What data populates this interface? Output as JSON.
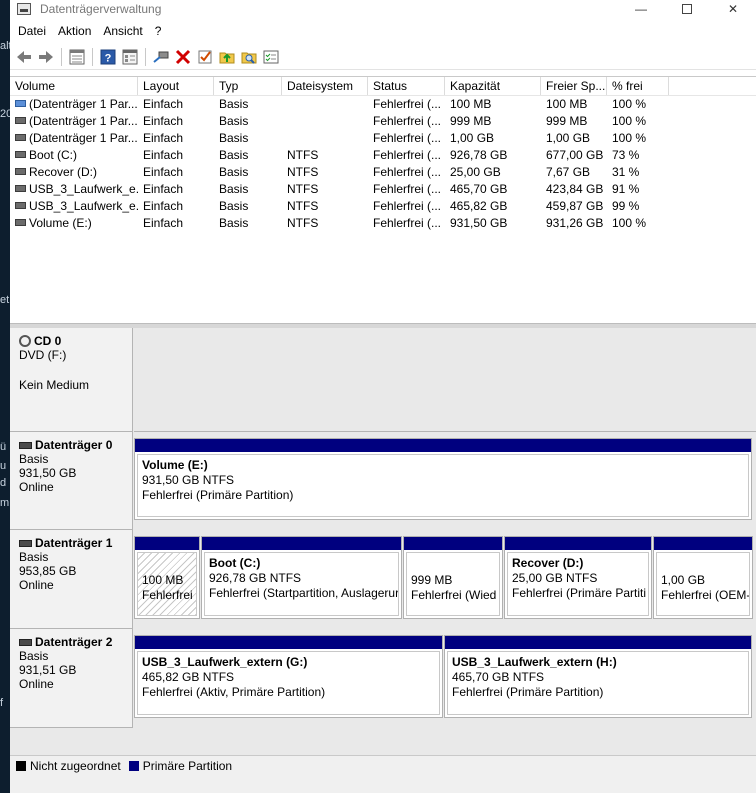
{
  "window": {
    "title": "Datenträgerverwaltung"
  },
  "menu": [
    "Datei",
    "Aktion",
    "Ansicht",
    "?"
  ],
  "desktop_fragments": [
    "alt",
    "20",
    "ü",
    "u",
    "d",
    "et",
    "m",
    "f"
  ],
  "toolbar_icons": [
    "back-icon",
    "forward-icon",
    "list-view-icon",
    "help-icon",
    "properties-icon",
    "connect-icon",
    "delete-icon",
    "check-icon",
    "folder-up-icon",
    "search-folder-icon",
    "properties-list-icon"
  ],
  "columns": [
    "Volume",
    "Layout",
    "Typ",
    "Dateisystem",
    "Status",
    "Kapazität",
    "Freier Sp...",
    "% frei"
  ],
  "volumes": [
    {
      "name": "(Datenträger 1 Par...",
      "layout": "Einfach",
      "type": "Basis",
      "fs": "",
      "status": "Fehlerfrei (...",
      "capacity": "100 MB",
      "free": "100 MB",
      "pct": "100 %",
      "icon": "blue"
    },
    {
      "name": "(Datenträger 1 Par...",
      "layout": "Einfach",
      "type": "Basis",
      "fs": "",
      "status": "Fehlerfrei (...",
      "capacity": "999 MB",
      "free": "999 MB",
      "pct": "100 %",
      "icon": "gray"
    },
    {
      "name": "(Datenträger 1 Par...",
      "layout": "Einfach",
      "type": "Basis",
      "fs": "",
      "status": "Fehlerfrei (...",
      "capacity": "1,00 GB",
      "free": "1,00 GB",
      "pct": "100 %",
      "icon": "gray"
    },
    {
      "name": "Boot (C:)",
      "layout": "Einfach",
      "type": "Basis",
      "fs": "NTFS",
      "status": "Fehlerfrei (...",
      "capacity": "926,78 GB",
      "free": "677,00 GB",
      "pct": "73 %",
      "icon": "gray"
    },
    {
      "name": "Recover (D:)",
      "layout": "Einfach",
      "type": "Basis",
      "fs": "NTFS",
      "status": "Fehlerfrei (...",
      "capacity": "25,00 GB",
      "free": "7,67 GB",
      "pct": "31 %",
      "icon": "gray"
    },
    {
      "name": "USB_3_Laufwerk_e...",
      "layout": "Einfach",
      "type": "Basis",
      "fs": "NTFS",
      "status": "Fehlerfrei (...",
      "capacity": "465,70 GB",
      "free": "423,84 GB",
      "pct": "91 %",
      "icon": "gray"
    },
    {
      "name": "USB_3_Laufwerk_e...",
      "layout": "Einfach",
      "type": "Basis",
      "fs": "NTFS",
      "status": "Fehlerfrei (...",
      "capacity": "465,82 GB",
      "free": "459,87 GB",
      "pct": "99 %",
      "icon": "gray"
    },
    {
      "name": "Volume (E:)",
      "layout": "Einfach",
      "type": "Basis",
      "fs": "NTFS",
      "status": "Fehlerfrei (...",
      "capacity": "931,50 GB",
      "free": "931,26 GB",
      "pct": "100 %",
      "icon": "gray"
    }
  ],
  "disks": [
    {
      "name": "CD 0",
      "line1": "DVD (F:)",
      "line2": "",
      "line3": "Kein Medium",
      "partitions": []
    },
    {
      "name": "Datenträger 0",
      "line1": "Basis",
      "line2": "931,50 GB",
      "line3": "Online",
      "partitions": [
        {
          "name": "Volume  (E:)",
          "size": "931,50 GB NTFS",
          "status": "Fehlerfrei (Primäre Partition)"
        }
      ]
    },
    {
      "name": "Datenträger 1",
      "line1": "Basis",
      "line2": "953,85 GB",
      "line3": "Online",
      "partitions": [
        {
          "name": "",
          "size": "100 MB",
          "status": "Fehlerfrei",
          "system": true
        },
        {
          "name": "Boot  (C:)",
          "size": "926,78 GB NTFS",
          "status": "Fehlerfrei (Startpartition, Auslagerur"
        },
        {
          "name": "",
          "size": "999 MB",
          "status": "Fehlerfrei (Wied"
        },
        {
          "name": "Recover  (D:)",
          "size": "25,00 GB NTFS",
          "status": "Fehlerfrei (Primäre Partiti"
        },
        {
          "name": "",
          "size": "1,00 GB",
          "status": "Fehlerfrei (OEM-"
        }
      ]
    },
    {
      "name": "Datenträger 2",
      "line1": "Basis",
      "line2": "931,51 GB",
      "line3": "Online",
      "partitions": [
        {
          "name": "USB_3_Laufwerk_extern  (G:)",
          "size": "465,82 GB NTFS",
          "status": "Fehlerfrei (Aktiv, Primäre Partition)"
        },
        {
          "name": "USB_3_Laufwerk_extern  (H:)",
          "size": "465,70 GB NTFS",
          "status": "Fehlerfrei (Primäre Partition)"
        }
      ]
    }
  ],
  "legend": [
    {
      "label": "Nicht zugeordnet",
      "color": "#000000"
    },
    {
      "label": "Primäre Partition",
      "color": "#00007f"
    }
  ]
}
